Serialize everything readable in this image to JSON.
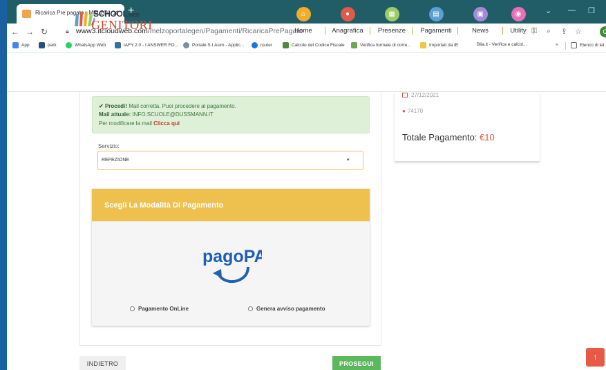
{
  "browser": {
    "tab_title": "Ricarica Pre pagato - MELZO",
    "tab_close": "✕",
    "new_tab": "+",
    "url_host": "www3.itcloudweb.com",
    "url_path": "/melzoportalegen/Pagamenti/RicaricaPrePagato",
    "avatar": "G",
    "bookmarks": [
      {
        "label": "App",
        "color": "#4285f4"
      },
      {
        "label": "park",
        "color": "#2b4d7e"
      },
      {
        "label": "WhatsApp Web",
        "color": "#25d366"
      },
      {
        "label": "IAFY 2.0 - I ANSWER FO...",
        "color": "#3a6fa8"
      },
      {
        "label": "Portale S.I.Asim - Applic...",
        "color": "#7b8fa3"
      },
      {
        "label": "router",
        "color": "#1a73e8"
      },
      {
        "label": "Calcolo del Codice Fiscale",
        "color": "#4b8b3b"
      },
      {
        "label": "Verifica formale di corre...",
        "color": "#6aa84f"
      },
      {
        "label": "Importati da IE",
        "color": "#f6c344"
      },
      {
        "label": "Blia.it - Verifica e calcol...",
        "color": "#ffffff"
      },
      {
        "label": "Elenco di let",
        "color": "#888888"
      }
    ],
    "bookmarks_more": "»"
  },
  "header": {
    "logo_school": "SCHOOL",
    "logo_web": ".WEB",
    "logo_genitori": "GENITORI",
    "nav": [
      {
        "label": "Home",
        "color": "#f0ad2c",
        "icon": "home-icon",
        "glyph": "⌂"
      },
      {
        "label": "Anagrafica",
        "color": "#e05a49",
        "icon": "user-icon",
        "glyph": "●"
      },
      {
        "label": "Presenze",
        "color": "#9ccc65",
        "icon": "calendar-icon",
        "glyph": "▦"
      },
      {
        "label": "Pagamenti",
        "color": "#5aa0d6",
        "icon": "card-icon",
        "glyph": "▤"
      },
      {
        "label": "News",
        "color": "#a48ad6",
        "icon": "news-icon",
        "glyph": "▣"
      },
      {
        "label": "Utility",
        "color": "#e870b8",
        "icon": "eye-icon",
        "glyph": "◉"
      }
    ]
  },
  "alert": {
    "check": "✔",
    "strong": "Procedi!",
    "text": "Mail corretta. Puoi procedere al pagamento.",
    "mail_label": "Mail attuale:",
    "mail_value": "INFO.SCUOLE@DUSSMANN.IT",
    "modify_text": "Per modificare la mail",
    "modify_link": "Clicca qui"
  },
  "servizio": {
    "label": "Servizio:",
    "value": "REFEZIONE",
    "arrow": "▾"
  },
  "payment": {
    "title": "Scegli La Modalità Di Pagamento",
    "logo_text": "pagoPA",
    "option_online": "Pagamento OnLine",
    "option_avviso": "Genera avviso pagamento"
  },
  "summary": {
    "date": "27/12/2021",
    "code": "74170",
    "total_label": "Totale Pagamento:",
    "total_value": "€10"
  },
  "buttons": {
    "back": "INDIETRO",
    "next": "PROSEGUI",
    "scroll_top": "↑"
  }
}
